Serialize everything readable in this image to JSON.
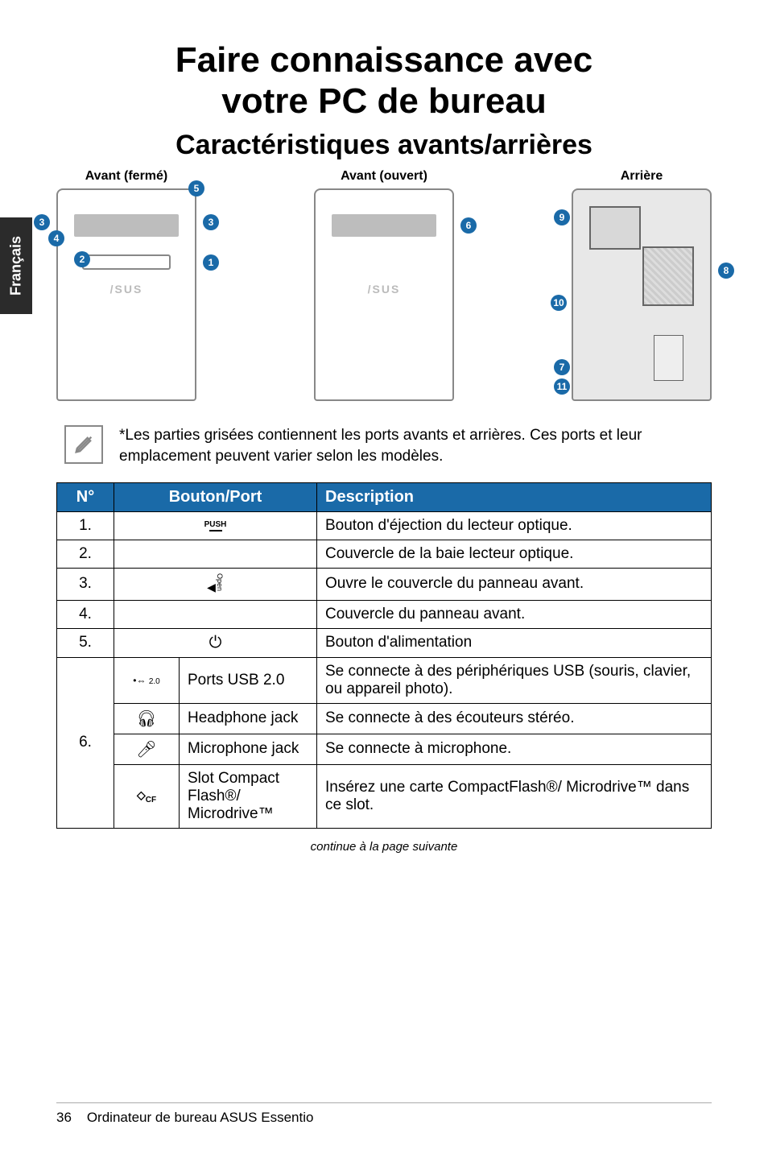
{
  "side_tab": "Français",
  "main_title_line1": "Faire connaissance avec",
  "main_title_line2": "votre PC de bureau",
  "sub_title": "Caractéristiques avants/arrières",
  "diagrams": {
    "front_closed": "Avant (fermé)",
    "front_open": "Avant (ouvert)",
    "rear": "Arrière"
  },
  "callouts": {
    "c1": "1",
    "c2": "2",
    "c3": "3",
    "c4": "4",
    "c5": "5",
    "c6": "6",
    "c7": "7",
    "c8": "8",
    "c9": "9",
    "c10": "10",
    "c11": "11"
  },
  "logo": "/SUS",
  "note_text": "*Les parties grisées contiennent les ports avants et arrières. Ces ports et leur emplacement peuvent varier selon les modèles.",
  "table": {
    "headers": {
      "num": "N°",
      "button": "Bouton/Port",
      "desc": "Description"
    },
    "rows": [
      {
        "num": "1.",
        "icon": "PUSH",
        "desc": "Bouton d'éjection du lecteur optique."
      },
      {
        "num": "2.",
        "icon": "",
        "desc": "Couvercle de la baie lecteur optique."
      },
      {
        "num": "3.",
        "icon": "open",
        "desc": "Ouvre le couvercle du panneau avant."
      },
      {
        "num": "4.",
        "icon": "",
        "desc": "Couvercle du panneau avant."
      },
      {
        "num": "5.",
        "icon": "power",
        "desc": "Bouton d'alimentation"
      }
    ],
    "row6": {
      "num": "6.",
      "sub": [
        {
          "icon": "usb",
          "name": "Ports USB 2.0",
          "desc": "Se connecte à des périphériques USB (souris, clavier, ou appareil photo)."
        },
        {
          "icon": "hp",
          "name": "Headphone jack",
          "desc": "Se connecte à des écouteurs stéréo."
        },
        {
          "icon": "mic",
          "name": "Microphone jack",
          "desc": "Se connecte à microphone."
        },
        {
          "icon": "cf",
          "name": "Slot Compact Flash®/ Microdrive™",
          "desc": "Insérez une carte CompactFlash®/ Microdrive™ dans ce slot."
        }
      ]
    }
  },
  "continue_text": "continue à la page suivante",
  "footer": {
    "page": "36",
    "text": "Ordinateur de bureau ASUS Essentio"
  }
}
